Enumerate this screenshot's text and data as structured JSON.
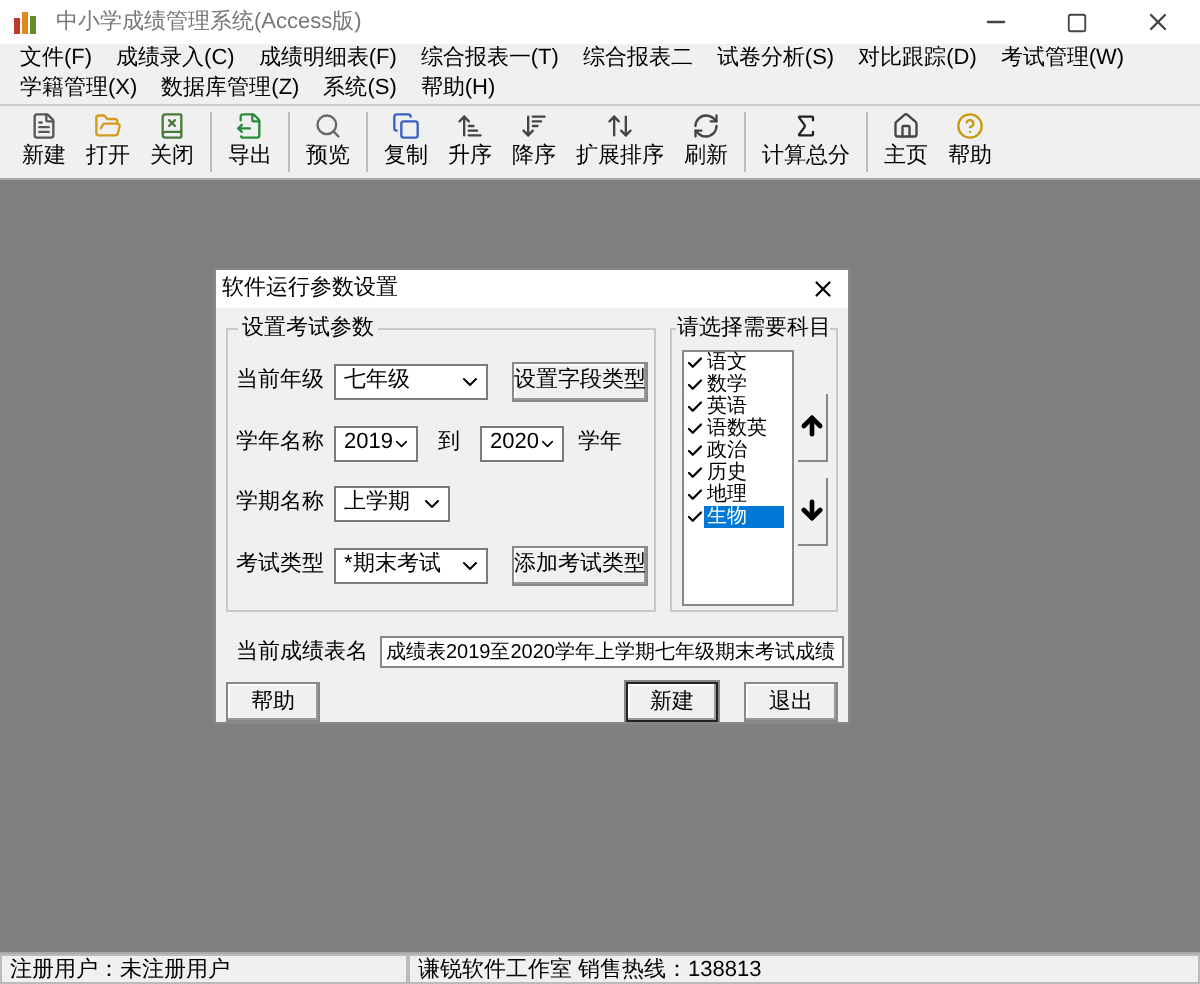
{
  "window": {
    "title": "中小学成绩管理系统(Access版)"
  },
  "menu": [
    "文件(F)",
    "成绩录入(C)",
    "成绩明细表(F)",
    "综合报表一(T)",
    "综合报表二",
    "试卷分析(S)",
    "对比跟踪(D)",
    "考试管理(W)",
    "学籍管理(X)",
    "数据库管理(Z)",
    "系统(S)",
    "帮助(H)"
  ],
  "toolbar": [
    [
      {
        "label": "新建",
        "kind": "new"
      },
      {
        "label": "打开",
        "kind": "open"
      },
      {
        "label": "关闭",
        "kind": "close"
      }
    ],
    [
      {
        "label": "导出",
        "kind": "export"
      }
    ],
    [
      {
        "label": "预览",
        "kind": "preview"
      }
    ],
    [
      {
        "label": "复制",
        "kind": "copy"
      },
      {
        "label": "升序",
        "kind": "asc"
      },
      {
        "label": "降序",
        "kind": "desc"
      },
      {
        "label": "扩展排序",
        "kind": "sort"
      },
      {
        "label": "刷新",
        "kind": "refresh"
      }
    ],
    [
      {
        "label": "计算总分",
        "kind": "sum"
      }
    ],
    [
      {
        "label": "主页",
        "kind": "home"
      },
      {
        "label": "帮助",
        "kind": "help"
      }
    ]
  ],
  "dialog": {
    "title": "软件运行参数设置",
    "group_title": "设置考试参数",
    "grade": {
      "label": "当前年级",
      "value": "七年级",
      "button": "设置字段类型"
    },
    "year": {
      "label": "学年名称",
      "from": "2019",
      "to_label": "到",
      "to": "2020",
      "suffix": "学年"
    },
    "term": {
      "label": "学期名称",
      "value": "上学期"
    },
    "exam": {
      "label": "考试类型",
      "value": "*期末考试",
      "button": "添加考试类型"
    },
    "subjects_title": "请选择需要科目",
    "subjects": [
      {
        "label": "语文",
        "checked": true,
        "selected": false
      },
      {
        "label": "数学",
        "checked": true,
        "selected": false
      },
      {
        "label": "英语",
        "checked": true,
        "selected": false
      },
      {
        "label": "语数英",
        "checked": true,
        "selected": false
      },
      {
        "label": "政治",
        "checked": true,
        "selected": false
      },
      {
        "label": "历史",
        "checked": true,
        "selected": false
      },
      {
        "label": "地理",
        "checked": true,
        "selected": false
      },
      {
        "label": "生物",
        "checked": true,
        "selected": true
      }
    ],
    "table_name": {
      "label": "当前成绩表名",
      "value": "成绩表2019至2020学年上学期七年级期末考试成绩"
    },
    "buttons": {
      "help": "帮助",
      "new": "新建",
      "exit": "退出"
    }
  },
  "status_bar": [
    "注册用户：未注册用户",
    "谦锐软件工作室  销售热线：138813"
  ]
}
